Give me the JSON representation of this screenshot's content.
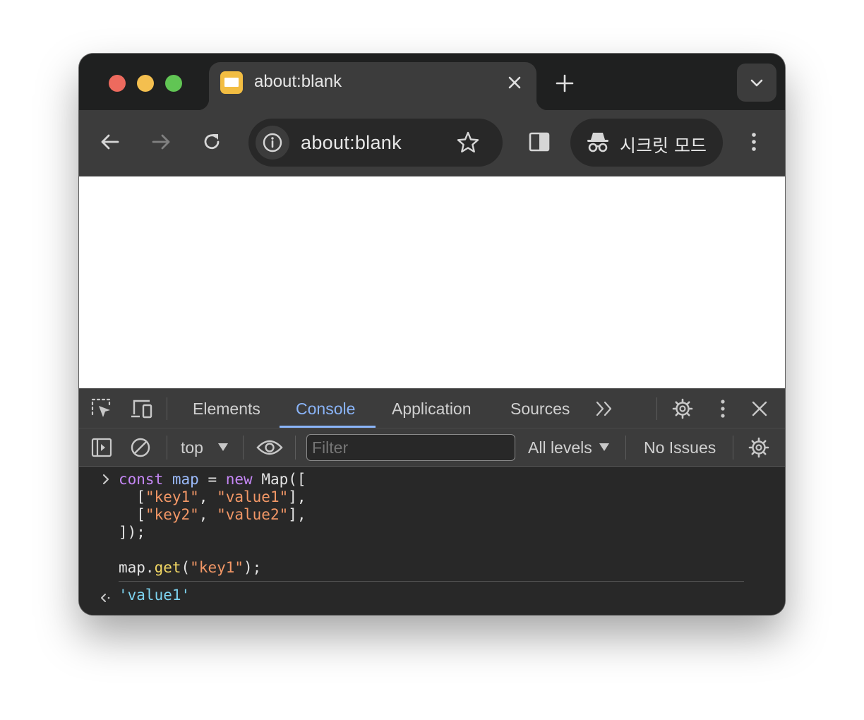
{
  "tab": {
    "title": "about:blank",
    "close_icon": "close-icon"
  },
  "omnibox": {
    "url": "about:blank"
  },
  "incognito": {
    "label": "시크릿 모드"
  },
  "devtools": {
    "tabs": [
      "Elements",
      "Console",
      "Application",
      "Sources"
    ],
    "active_tab": "Console",
    "context": "top",
    "filter_placeholder": "Filter",
    "levels": "All levels",
    "issues": "No Issues"
  },
  "console": {
    "input_lines": [
      "const map = new Map([",
      "  [\"key1\", \"value1\"],",
      "  [\"key2\", \"value2\"],",
      "]);",
      "",
      "map.get(\"key1\");"
    ],
    "result": "'value1'"
  },
  "colors": {
    "keyword": "#c587f5",
    "variable": "#9bbbfc",
    "string": "#f29766",
    "function": "#f3d864",
    "result": "#7dd3f0",
    "active_tab": "#8ab4f8"
  }
}
